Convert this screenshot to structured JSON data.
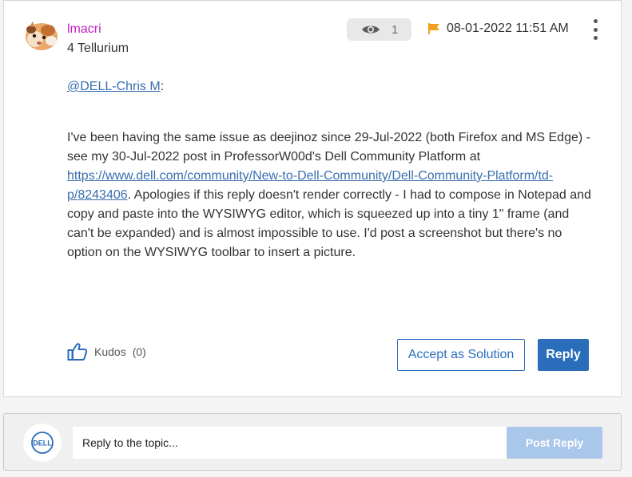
{
  "post": {
    "author": {
      "username": "lmacri",
      "rank": "4 Tellurium",
      "avatar_icon": "guinea-pig-avatar"
    },
    "views": {
      "icon": "eye-icon",
      "count": "1"
    },
    "flag_icon": "flag-icon",
    "date": "08-01-2022 11:51 AM",
    "menu_icon": "kebab-menu-icon",
    "mention": "@DELL-Chris M",
    "mention_suffix": ":",
    "body": {
      "text_before_link": "I've been having the same issue as deejinoz since 29-Jul-2022 (both Firefox and MS Edge) - see my 30-Jul-2022 post in ProfessorW00d's Dell Community Platform at ",
      "link": "https://www.dell.com/community/New-to-Dell-Community/Dell-Community-Platform/td-p/8243406",
      "text_after_link": ". Apologies if this reply doesn't render correctly - I had to compose in Notepad and copy and paste into the WYSIWYG editor, which is squeezed up into a tiny 1\" frame (and can't be expanded) and is almost impossible to use. I'd post a screenshot but there's no option on the WYSIWYG toolbar to insert a picture."
    },
    "kudos": {
      "icon": "thumbs-up-icon",
      "label": "Kudos",
      "count": "(0)"
    },
    "accept_label": "Accept as Solution",
    "reply_label": "Reply"
  },
  "reply_bar": {
    "logo_text": "DELL",
    "placeholder": "Reply to the topic...",
    "post_reply_label": "Post Reply"
  },
  "colors": {
    "username": "#c41fbe",
    "link": "#3a6fae",
    "primary_button": "#2a6ebb",
    "disabled_button": "#a9c7e8",
    "flag": "#f0a01e"
  }
}
